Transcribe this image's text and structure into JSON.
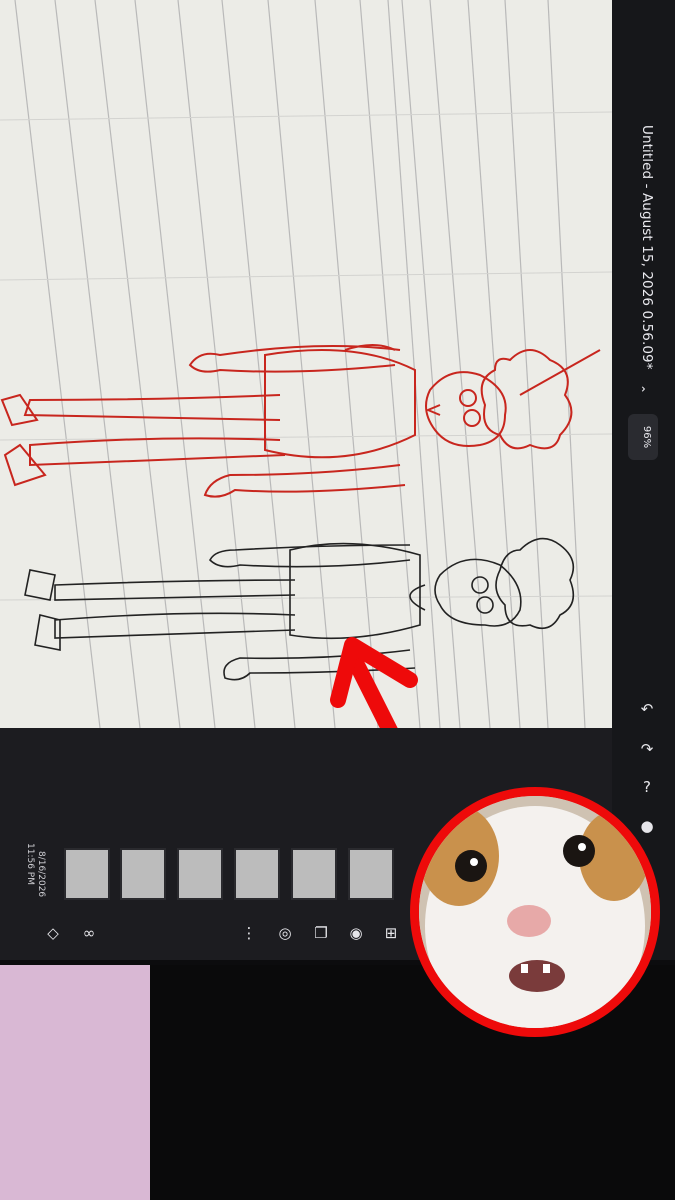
{
  "app": {
    "title": "Untitled - August 15, 2026 0.56.09*",
    "zoom": "96%"
  },
  "taskbar": {
    "time": "11:56 PM",
    "date": "8/16/2026"
  },
  "toolbar": {
    "undo": "undo",
    "redo": "redo",
    "help": "help",
    "account": "account"
  },
  "frames": {
    "count": 7
  },
  "colors": {
    "annotation": "#ee0a0a",
    "red_sketch": "#c8261e",
    "black_sketch": "#222222",
    "canvas": "#ecece7"
  },
  "icons": [
    "undo-icon",
    "redo-icon",
    "help-icon",
    "account-icon",
    "add-frame-icon",
    "onion-skin-icon",
    "layers-icon"
  ]
}
